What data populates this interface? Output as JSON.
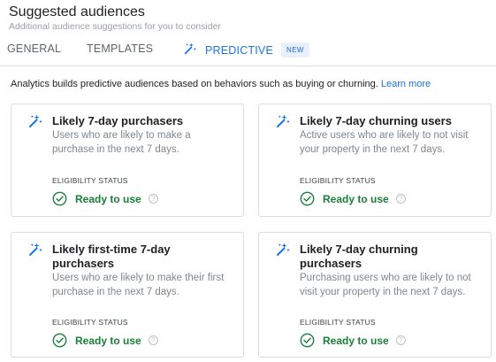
{
  "header": {
    "title": "Suggested audiences",
    "subtitle": "Additional audience suggestions for you to consider"
  },
  "tabs": [
    {
      "label": "GENERAL",
      "active": false
    },
    {
      "label": "TEMPLATES",
      "active": false
    },
    {
      "label": "PREDICTIVE",
      "active": true,
      "badge": "NEW",
      "icon": "magic-wand-icon"
    }
  ],
  "intro": {
    "text": "Analytics builds predictive audiences based on behaviors such as buying or churning.",
    "link": "Learn more"
  },
  "cards": [
    {
      "title": "Likely 7-day purchasers",
      "description": "Users who are likely to make a purchase in the next 7 days.",
      "eligibility_label": "ELIGIBILITY STATUS",
      "status": "Ready to use",
      "help": "?"
    },
    {
      "title": "Likely 7-day churning users",
      "description": "Active users who are likely to not visit your property in the next 7 days.",
      "eligibility_label": "ELIGIBILITY STATUS",
      "status": "Ready to use",
      "help": "?"
    },
    {
      "title": "Likely first-time 7-day purchasers",
      "description": "Users who are likely to make their first purchase in the next 7 days.",
      "eligibility_label": "ELIGIBILITY STATUS",
      "status": "Ready to use",
      "help": "?"
    },
    {
      "title": "Likely 7-day churning purchasers",
      "description": "Purchasing users who are likely to not visit your property in the next 7 days.",
      "eligibility_label": "ELIGIBILITY STATUS",
      "status": "Ready to use",
      "help": "?"
    }
  ],
  "colors": {
    "accent": "#1a73e8",
    "success": "#188038",
    "badge_bg": "#e8f0fe"
  }
}
